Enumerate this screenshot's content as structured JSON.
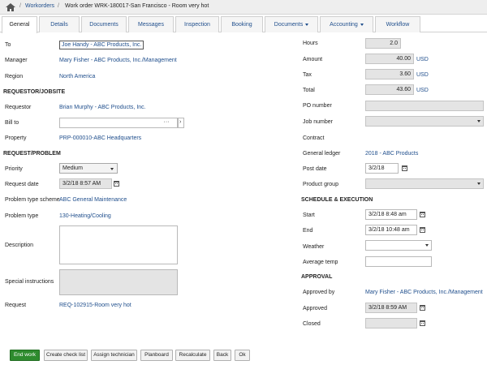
{
  "breadcrumb": {
    "home_icon": "home-icon",
    "workorders": "Workorders",
    "separator": "/",
    "current": "Work order WRK-180017-San Francisco - Room very hot"
  },
  "tabs": [
    "General",
    "Details",
    "Documents",
    "Messages",
    "Inspection",
    "Booking",
    "Documents",
    "Accounting",
    "Workflow"
  ],
  "left": {
    "to_label": "To",
    "to_value": "Joe Handy - ABC Products, Inc.",
    "manager_label": "Manager",
    "manager_value": "Mary Fisher - ABC Products, Inc./Management",
    "region_label": "Region",
    "region_value": "North America",
    "requestor_section": "REQUESTOR/JOBSITE",
    "requestor_label": "Requestor",
    "requestor_value": "Brian Murphy - ABC Products, Inc.",
    "billto_label": "Bill to",
    "billto_dots": "···",
    "billto_arrow": "›",
    "property_label": "Property",
    "property_value": "PRP-000010-ABC Headquarters",
    "request_section": "REQUEST/PROBLEM",
    "priority_label": "Priority",
    "priority_value": "Medium",
    "reqdate_label": "Request date",
    "reqdate_value": "3/2/18 8:57 AM",
    "scheme_label": "Problem type scheme",
    "scheme_value": "ABC General Maintenance",
    "ptype_label": "Problem type",
    "ptype_value": "130-Heating/Cooling",
    "desc_label": "Description",
    "special_label": "Special instructions",
    "request_label": "Request",
    "request_value": "REQ-102915-Room very hot"
  },
  "right": {
    "hours_label": "Hours",
    "hours_value": "2.0",
    "amount_label": "Amount",
    "amount_value": "40.00",
    "tax_label": "Tax",
    "tax_value": "3.60",
    "total_label": "Total",
    "total_value": "43.60",
    "currency": "USD",
    "po_label": "PO number",
    "job_label": "Job number",
    "contract_label": "Contract",
    "gl_label": "General ledger",
    "gl_value": "2018 - ABC Products",
    "postdate_label": "Post date",
    "postdate_value": "3/2/18",
    "pgroup_label": "Product group",
    "sched_section": "SCHEDULE & EXECUTION",
    "start_label": "Start",
    "start_value": "3/2/18 8:48 am",
    "end_label": "End",
    "end_value": "3/2/18 10:48 am",
    "weather_label": "Weather",
    "avgtemp_label": "Average temp",
    "approval_section": "APPROVAL",
    "approvedby_label": "Approved by",
    "approvedby_value": "Mary Fisher - ABC Products, Inc./Management",
    "approved_label": "Approved",
    "approved_value": "3/2/18 8:59 AM",
    "closed_label": "Closed"
  },
  "buttons": {
    "end_work": "End work",
    "create_check_list": "Create check list",
    "assign_technician": "Assign technician",
    "planboard": "Planboard",
    "recalculate": "Recalculate",
    "back": "Back",
    "ok": "Ok"
  },
  "colors": {
    "link": "#1f4e8c",
    "primary_button": "#2e8b2e",
    "readonly_field": "#e4e4e4"
  }
}
